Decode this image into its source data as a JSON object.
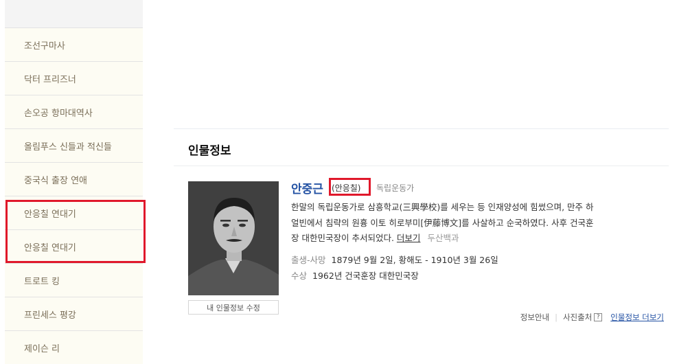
{
  "sidebar": {
    "items": [
      {
        "label": "조선구마사"
      },
      {
        "label": "닥터 프리즈너"
      },
      {
        "label": "손오공 항마대역사"
      },
      {
        "label": "올림푸스 신들과 적신들"
      },
      {
        "label": "중국식 출장 연애"
      },
      {
        "label": "안응칠 연대기"
      },
      {
        "label": "안응칠 연대기"
      },
      {
        "label": "트로트 킹"
      },
      {
        "label": "프린세스 평강"
      },
      {
        "label": "제이슨 리"
      }
    ]
  },
  "profile": {
    "section_title": "인물정보",
    "name": "안중근",
    "alias": "(안응칠)",
    "role": "독립운동가",
    "desc_line1": "한말의 독립운동가로 삼흥학교(三興學校)를 세우는 등 인재양성에 힘썼으며, 만주 하",
    "desc_line2": "얼빈에서 침략의 원흉 이토 히로부미[伊藤博文]를 사살하고 순국하였다. 사후 건국훈",
    "desc_line3": "장 대한민국장이 추서되었다.",
    "more": "더보기",
    "source": "두산백과",
    "birth_label": "출생-사망",
    "birth_value": "1879년 9월 2일, 황해도 - 1910년 3월 26일",
    "award_label": "수상",
    "award_value": "1962년 건국훈장 대한민국장",
    "edit_button": "내 인물정보 수정",
    "photo_icon": "portrait-photo"
  },
  "footer": {
    "info_guide": "정보안내",
    "photo_source": "사진출처",
    "help_glyph": "?",
    "more_person": "인물정보 더보기"
  },
  "colors": {
    "highlight_box": "#e0182b",
    "link_blue": "#2553a4",
    "sidebar_bg": "#fdfcf3",
    "sidebar_text": "#7a6e58"
  }
}
